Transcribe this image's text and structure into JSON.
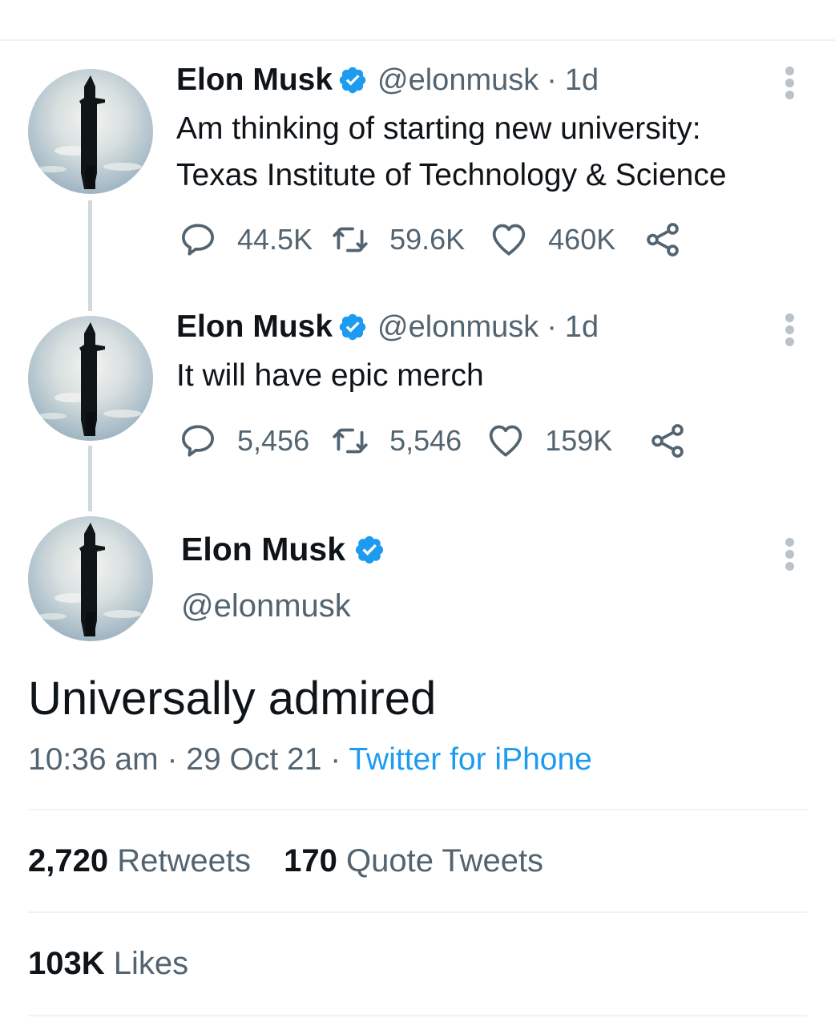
{
  "thread": [
    {
      "author": {
        "name": "Elon Musk",
        "handle": "@elonmusk",
        "verified": true
      },
      "time": "1d",
      "text_lines": [
        "Am thinking of starting new university:",
        "Texas Institute of Technology & Science"
      ],
      "counts": {
        "replies": "44.5K",
        "retweets": "59.6K",
        "likes": "460K"
      }
    },
    {
      "author": {
        "name": "Elon Musk",
        "handle": "@elonmusk",
        "verified": true
      },
      "time": "1d",
      "text_lines": [
        "It will have epic merch"
      ],
      "counts": {
        "replies": "5,456",
        "retweets": "5,546",
        "likes": "159K"
      }
    }
  ],
  "main_tweet": {
    "author": {
      "name": "Elon Musk",
      "handle": "@elonmusk",
      "verified": true
    },
    "text": "Universally admired",
    "time": "10:36 am",
    "date": "29 Oct 21",
    "separator": "·",
    "source": "Twitter for iPhone",
    "stats": {
      "retweets_value": "2,720",
      "retweets_label": "Retweets",
      "quotes_value": "170",
      "quotes_label": "Quote Tweets",
      "likes_value": "103K",
      "likes_label": "Likes"
    }
  },
  "icons": {
    "reply": "reply-icon",
    "retweet": "retweet-icon",
    "like": "like-icon",
    "share": "share-icon",
    "verified": "verified-badge-icon",
    "more": "more-options-icon"
  },
  "colors": {
    "text": "#0f1419",
    "secondary": "#536471",
    "link": "#1d9bf0",
    "verified": "#1d9bf0",
    "divider": "#eff3f4",
    "thread_line": "#cfd9de"
  }
}
